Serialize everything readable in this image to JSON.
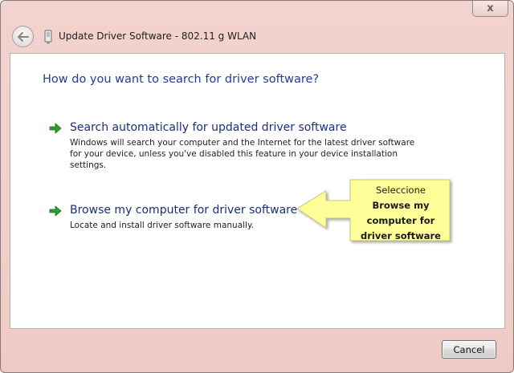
{
  "window": {
    "title": "Update Driver Software - 802.11 g WLAN",
    "close_label": "x"
  },
  "main": {
    "heading": "How do you want to search for driver software?",
    "options": [
      {
        "title": "Search automatically for updated driver software",
        "description": "Windows will search your computer and the Internet for the latest driver software for your device, unless you've disabled this feature in your device installation settings."
      },
      {
        "title": "Browse my computer for driver software",
        "description": "Locate and install driver software manually."
      }
    ]
  },
  "callout": {
    "line1": "Seleccione",
    "line2": "Browse my",
    "line3": "computer for",
    "line4": "driver software"
  },
  "footer": {
    "cancel_label": "Cancel"
  },
  "icons": {
    "back": "back-arrow-icon",
    "device": "network-adapter-icon",
    "option_arrow": "green-arrow-icon"
  },
  "colors": {
    "heading": "#1f3d9b",
    "option_title": "#1a2f7a",
    "callout_fill": "#ffff99",
    "arrow_green": "#2e9e2e"
  }
}
